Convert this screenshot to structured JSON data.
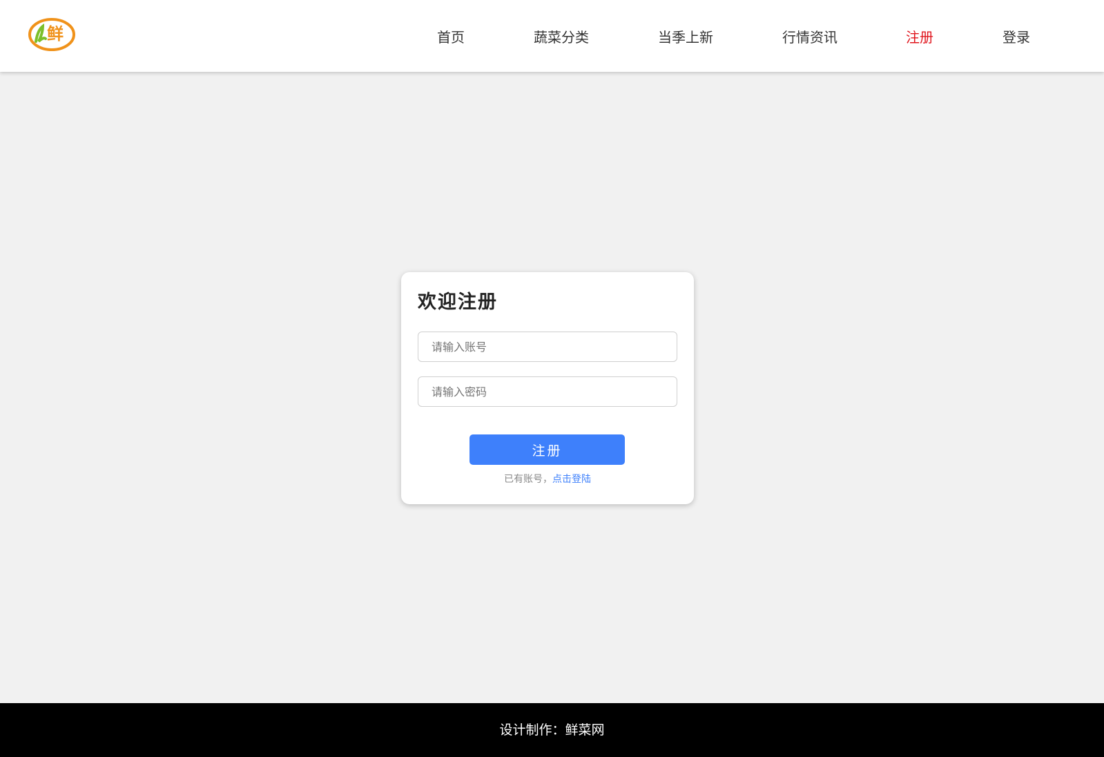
{
  "header": {
    "logo": {
      "text": "鲜",
      "accent_color": "#f0921a",
      "leaf_color": "#7cbf2a"
    },
    "nav": [
      {
        "label": "首页",
        "active": false
      },
      {
        "label": "蔬菜分类",
        "active": false
      },
      {
        "label": "当季上新",
        "active": false
      },
      {
        "label": "行情资讯",
        "active": false
      },
      {
        "label": "注册",
        "active": true
      },
      {
        "label": "登录",
        "active": false
      }
    ],
    "active_color": "#e0141c"
  },
  "register": {
    "title": "欢迎注册",
    "account_placeholder": "请输入账号",
    "password_placeholder": "请输入密码",
    "submit_label": "注册",
    "hint_text": "已有账号，",
    "login_link": "点击登陆",
    "button_color": "#3e80fb"
  },
  "footer": {
    "text": "设计制作：鲜菜网"
  }
}
